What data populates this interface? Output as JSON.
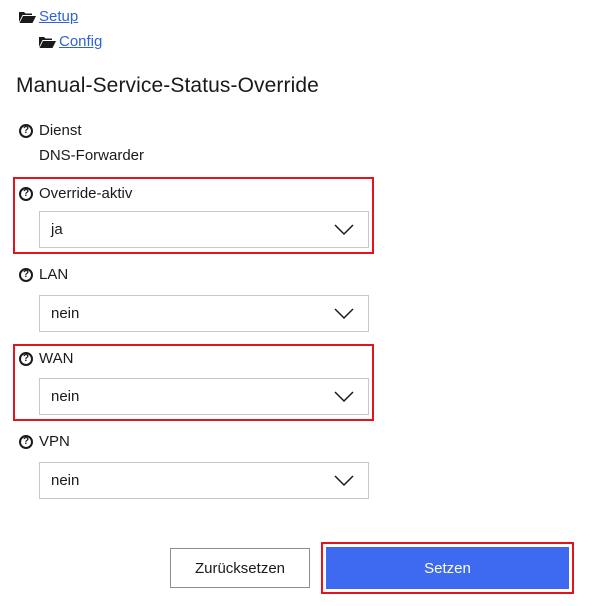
{
  "breadcrumb": {
    "items": [
      {
        "label": "Setup",
        "icon": "folder-open-icon"
      },
      {
        "label": "Config",
        "icon": "folder-open-icon"
      }
    ]
  },
  "page": {
    "title": "Manual-Service-Status-Override"
  },
  "form": {
    "dienst": {
      "label": "Dienst",
      "value": "DNS-Forwarder"
    },
    "override_aktiv": {
      "label": "Override-aktiv",
      "value": "ja"
    },
    "lan": {
      "label": "LAN",
      "value": "nein"
    },
    "wan": {
      "label": "WAN",
      "value": "nein"
    },
    "vpn": {
      "label": "VPN",
      "value": "nein"
    },
    "help_glyph": "?"
  },
  "actions": {
    "reset_label": "Zurücksetzen",
    "submit_label": "Setzen"
  },
  "colors": {
    "link": "#2f62d6",
    "primary_button": "#3d6af0",
    "highlight": "#e3141b"
  }
}
